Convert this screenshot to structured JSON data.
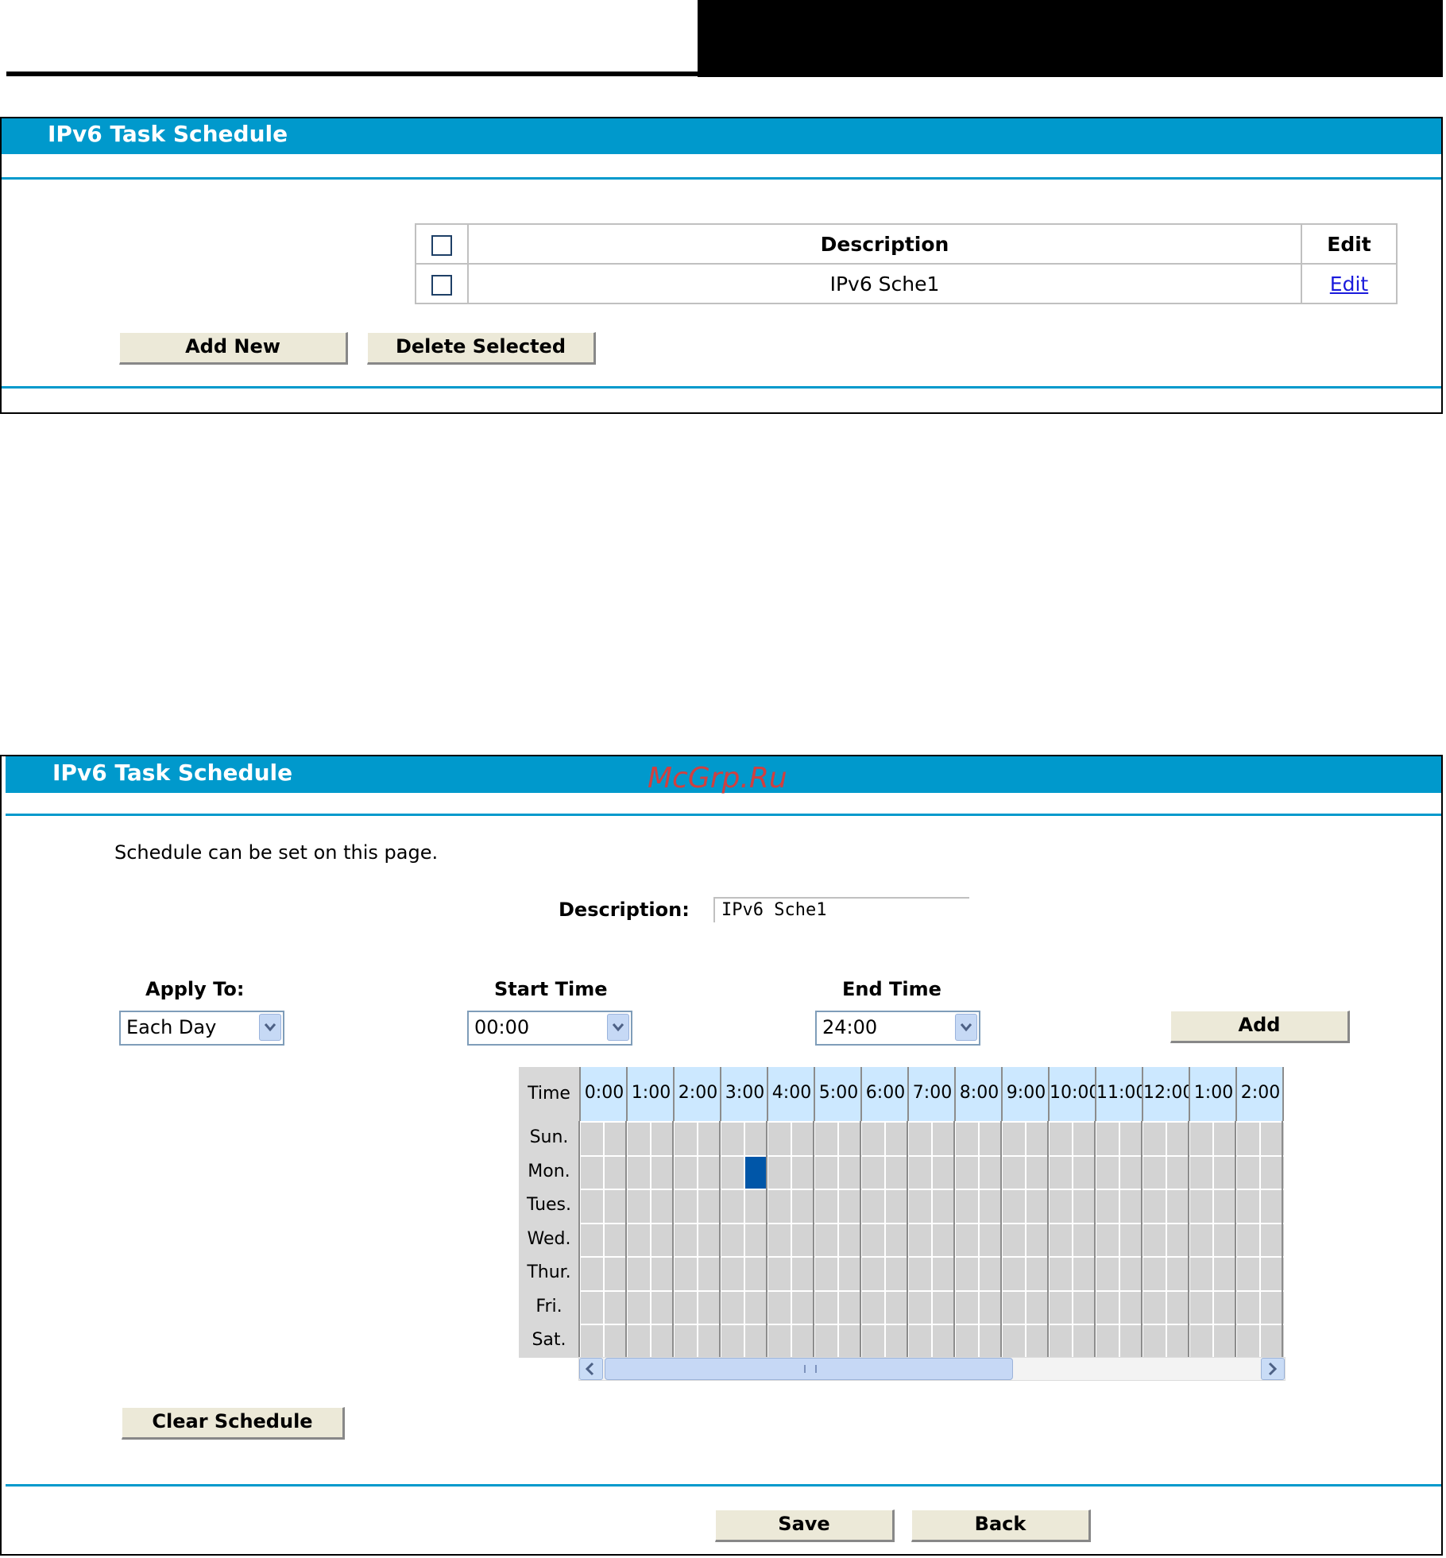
{
  "watermark": "McGrp.Ru",
  "list_panel": {
    "title": "IPv6 Task Schedule",
    "table": {
      "headers": [
        "Description",
        "Edit"
      ],
      "rows": [
        {
          "description": "IPv6 Sche1",
          "edit_label": "Edit"
        }
      ]
    },
    "buttons": {
      "add_new": "Add New",
      "delete_selected": "Delete Selected"
    }
  },
  "edit_panel": {
    "title": "IPv6 Task Schedule",
    "intro": "Schedule can be set on this page.",
    "description_label": "Description:",
    "description_value": "IPv6 Sche1",
    "apply_to_label": "Apply To:",
    "apply_to_value": "Each Day",
    "start_time_label": "Start Time",
    "start_time_value": "00:00",
    "end_time_label": "End Time",
    "end_time_value": "24:00",
    "add_button": "Add",
    "grid": {
      "corner_label": "Time",
      "hours": [
        "0:00",
        "1:00",
        "2:00",
        "3:00",
        "4:00",
        "5:00",
        "6:00",
        "7:00",
        "8:00",
        "9:00",
        "10:00",
        "11:00",
        "12:00",
        "1:00",
        "2:00"
      ],
      "days": [
        "Sun.",
        "Mon.",
        "Tues.",
        "Wed.",
        "Thur.",
        "Fri.",
        "Sat."
      ],
      "selected_cells": [
        {
          "day": "Mon.",
          "hour": "3:00",
          "half": 2
        }
      ]
    },
    "clear_button": "Clear Schedule",
    "save_button": "Save",
    "back_button": "Back"
  }
}
